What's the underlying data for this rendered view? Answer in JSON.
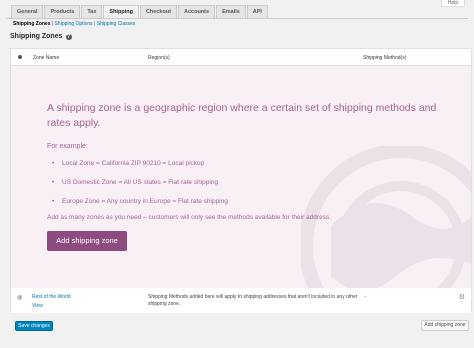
{
  "help": "Help",
  "tabs": [
    {
      "label": "General"
    },
    {
      "label": "Products"
    },
    {
      "label": "Tax"
    },
    {
      "label": "Shipping"
    },
    {
      "label": "Checkout"
    },
    {
      "label": "Accounts"
    },
    {
      "label": "Emails"
    },
    {
      "label": "API"
    }
  ],
  "subnav": {
    "zones": "Shipping Zones",
    "options": "Shipping Options",
    "classes": "Shipping Classes",
    "separator": "|"
  },
  "heading": "Shipping Zones",
  "table": {
    "col_name": "Zone Name",
    "col_regions": "Region(s)",
    "col_methods": "Shipping Method(s)"
  },
  "blank": {
    "title": "A shipping zone is a geographic region where a certain set of shipping methods and rates apply.",
    "example": "For example:",
    "items": [
      "Local Zone = California ZIP 90210 = Local pickup",
      "US Domestic Zone = All US states = Flat rate shipping",
      "Europe Zone = Any country in Europe = Flat rate shipping"
    ],
    "note": "Add as many zones as you need – customers will only see the methods available for their address.",
    "button": "Add shipping zone"
  },
  "rest_row": {
    "name": "Rest of the World",
    "view": "View",
    "description": "Shipping Methods added here will apply to shipping addresses that aren't included in any other shipping zone.",
    "methods": "-"
  },
  "footer": {
    "save": "Save changes",
    "add": "Add shipping zone"
  },
  "colors": {
    "accent": "#a46497",
    "button": "#8e4b80",
    "link": "#0073aa",
    "primary": "#0085ba"
  }
}
